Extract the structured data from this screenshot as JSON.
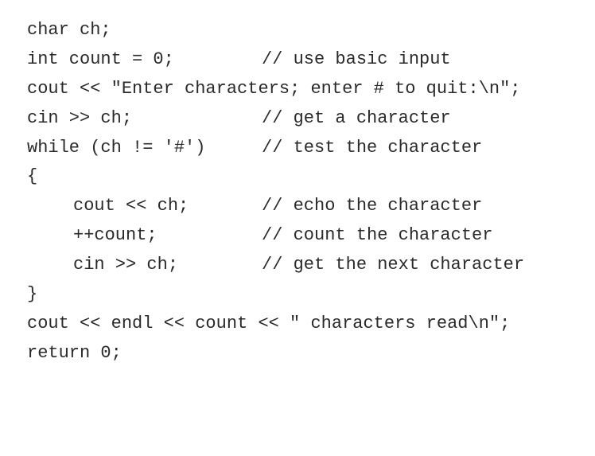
{
  "code_lines": [
    {
      "code": "char ch;",
      "comment": ""
    },
    {
      "code": "int count = 0;",
      "comment": "// use basic input"
    },
    {
      "code": "cout << \"Enter characters; enter # to quit:\\n\";",
      "comment": ""
    },
    {
      "code": "cin >> ch;",
      "comment": "// get a character"
    },
    {
      "code": "while (ch != '#')",
      "comment": "// test the character"
    },
    {
      "code": "{",
      "comment": ""
    },
    {
      "code": "cout << ch;",
      "comment": "// echo the character"
    },
    {
      "code": "++count;",
      "comment": "// count the character"
    },
    {
      "code": "cin >> ch;",
      "comment": "// get the next character"
    },
    {
      "code": "}",
      "comment": ""
    },
    {
      "code": "cout << endl << count << \" characters read\\n\";",
      "comment": ""
    },
    {
      "code": "return 0;",
      "comment": ""
    }
  ]
}
